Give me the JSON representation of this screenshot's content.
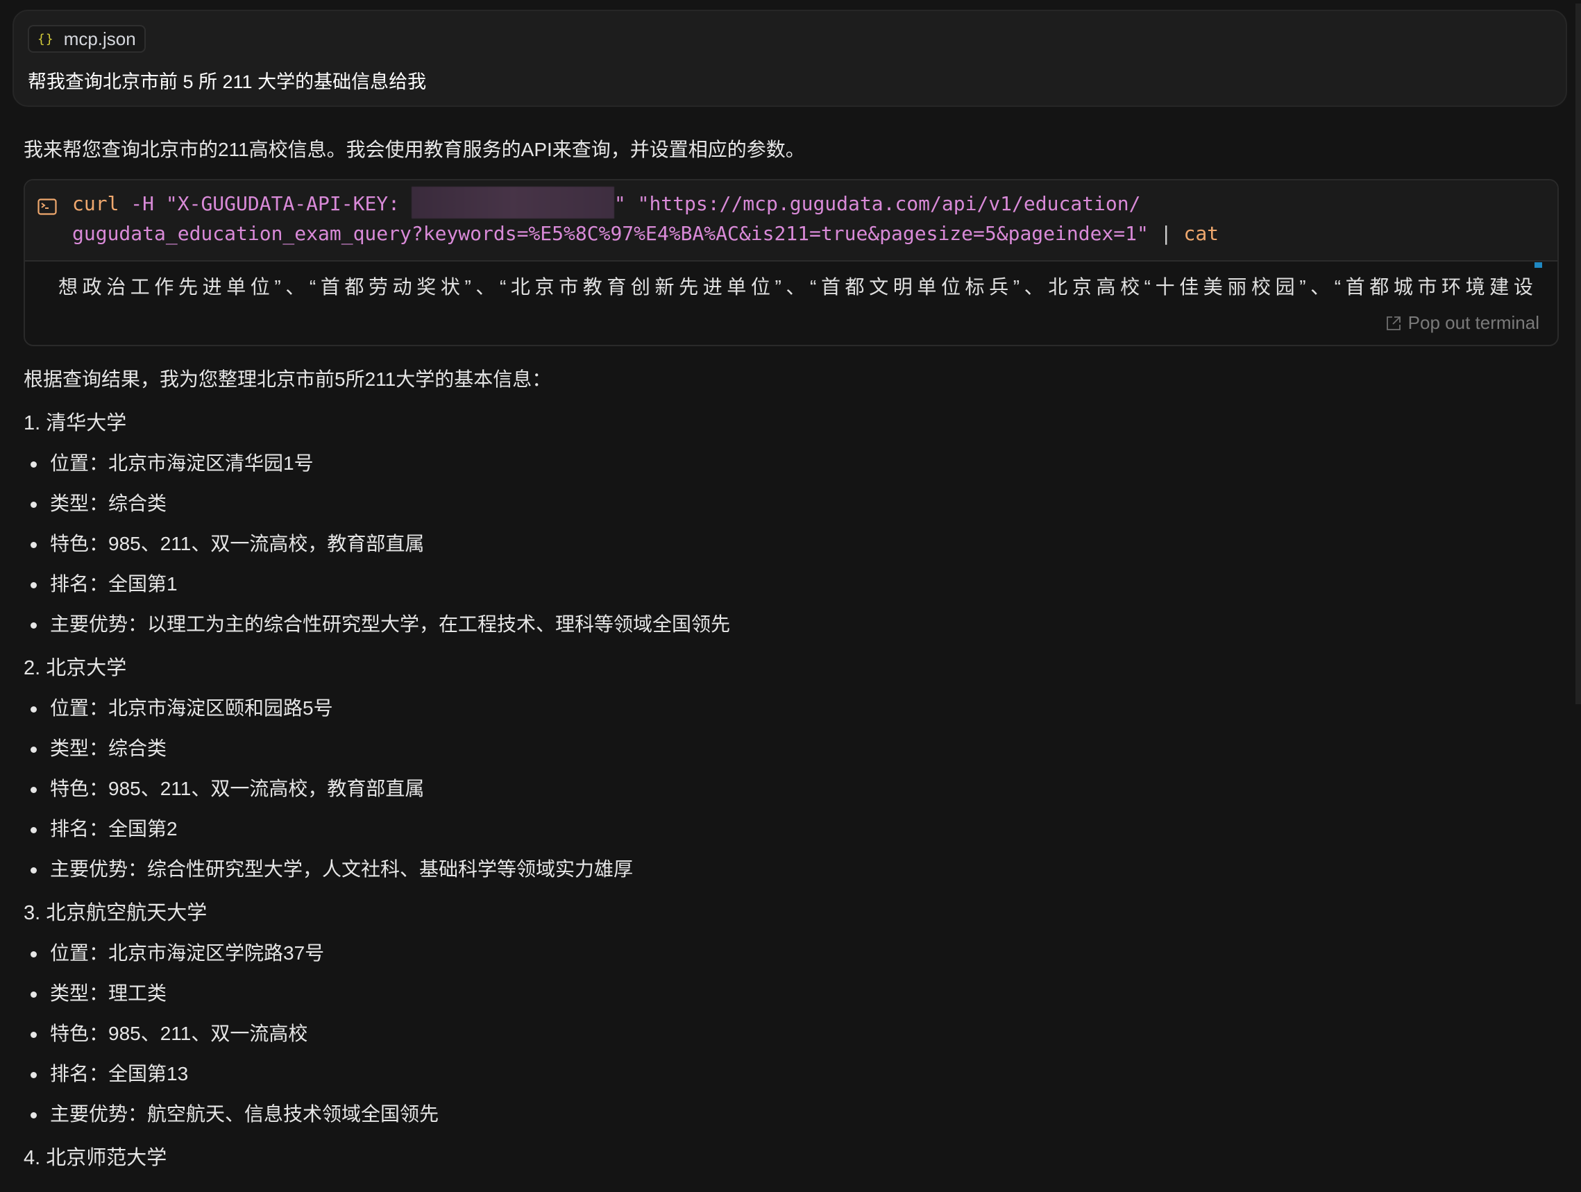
{
  "user_message": {
    "attachment": {
      "icon": "json-braces-icon",
      "glyph": "{}",
      "name": "mcp.json"
    },
    "text": "帮我查询北京市前 5 所 211 大学的基础信息给我"
  },
  "assistant": {
    "intro": "我来帮您查询北京市的211高校信息。我会使用教育服务的API来查询，并设置相应的参数。",
    "terminal": {
      "icon": "terminal-icon",
      "command": {
        "keyword": "curl",
        "line1_flag": " -H \"X-GUGUDATA-API-KEY:",
        "api_key": "[redacted]",
        "line1_rest": "\" \"https://mcp.gugudata.com/api/v1/education/",
        "line2": "gugudata_education_exam_query?keywords=%E5%8C%97%E4%BA%AC&is211=true&pagesize=5&pageindex=1\"",
        "pipe": "|",
        "pipe_cmd": "cat"
      },
      "output": "想政治工作先进单位”、“首都劳动奖状”、“北京市教育创新先进单位”、“首都文明单位标兵”、北京高校“十佳美丽校园”、“首都城市环境建设",
      "pop_out_label": "Pop out terminal",
      "accent_color": "#1f88c2"
    },
    "summary": "根据查询结果，我为您整理北京市前5所211大学的基本信息：",
    "universities": [
      {
        "title": "1. 清华大学",
        "items": [
          "位置：北京市海淀区清华园1号",
          "类型：综合类",
          "特色：985、211、双一流高校，教育部直属",
          "排名：全国第1",
          "主要优势：以理工为主的综合性研究型大学，在工程技术、理科等领域全国领先"
        ]
      },
      {
        "title": "2. 北京大学",
        "items": [
          "位置：北京市海淀区颐和园路5号",
          "类型：综合类",
          "特色：985、211、双一流高校，教育部直属",
          "排名：全国第2",
          "主要优势：综合性研究型大学，人文社科、基础科学等领域实力雄厚"
        ]
      },
      {
        "title": "3. 北京航空航天大学",
        "items": [
          "位置：北京市海淀区学院路37号",
          "类型：理工类",
          "特色：985、211、双一流高校",
          "排名：全国第13",
          "主要优势：航空航天、信息技术领域全国领先"
        ]
      },
      {
        "title": "4. 北京师范大学",
        "items": []
      }
    ]
  }
}
